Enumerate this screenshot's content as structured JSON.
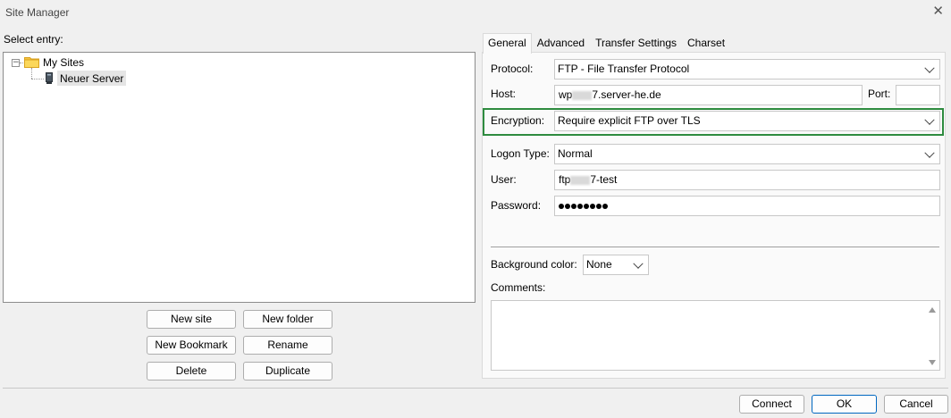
{
  "window": {
    "title": "Site Manager",
    "close_label": "✕"
  },
  "left": {
    "select_entry_label": "Select entry:",
    "tree": {
      "root_label": "My Sites",
      "expander": "−",
      "child_label": "Neuer Server"
    },
    "buttons": {
      "new_site": "New site",
      "new_folder": "New folder",
      "new_bookmark": "New Bookmark",
      "rename": "Rename",
      "delete": "Delete",
      "duplicate": "Duplicate"
    }
  },
  "tabs": [
    "General",
    "Advanced",
    "Transfer Settings",
    "Charset"
  ],
  "general": {
    "protocol_label": "Protocol:",
    "protocol_value": "FTP - File Transfer Protocol",
    "host_label": "Host:",
    "host_prefix": "wp",
    "host_suffix": "7.server-he.de",
    "port_label": "Port:",
    "port_value": "",
    "encryption_label": "Encryption:",
    "encryption_value": "Require explicit FTP over TLS",
    "logon_type_label": "Logon Type:",
    "logon_type_value": "Normal",
    "user_label": "User:",
    "user_prefix": "ftp",
    "user_suffix": "7-test",
    "password_label": "Password:",
    "password_length": 8,
    "background_color_label": "Background color:",
    "background_color_value": "None",
    "comments_label": "Comments:",
    "comments_value": ""
  },
  "footer": {
    "connect": "Connect",
    "ok": "OK",
    "cancel": "Cancel"
  },
  "colors": {
    "highlight_border": "#2e8b3f",
    "folder": "#f5c342"
  }
}
